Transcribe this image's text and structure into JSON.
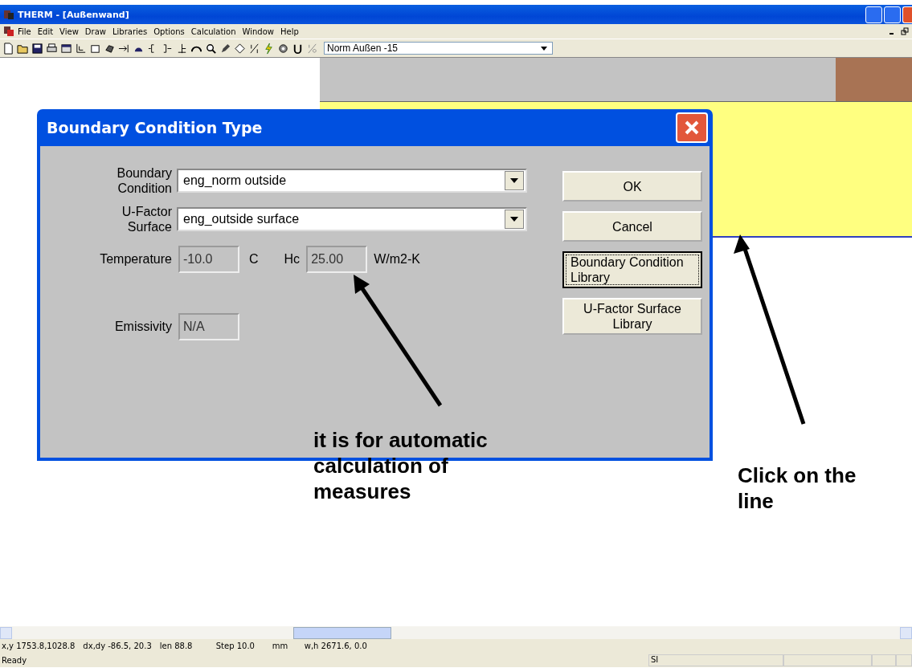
{
  "window": {
    "title": "THERM - [Außenwand]"
  },
  "menu": [
    "File",
    "Edit",
    "View",
    "Draw",
    "Libraries",
    "Options",
    "Calculation",
    "Window",
    "Help"
  ],
  "toolbar": {
    "condition_dropdown": "Norm Außen -15"
  },
  "dialog": {
    "title": "Boundary Condition Type",
    "selects": [
      {
        "label": "Boundary Condition",
        "value": "eng_norm outside"
      },
      {
        "label": "U-Factor Surface",
        "value": "eng_outside surface"
      }
    ],
    "temperature": {
      "label": "Temperature",
      "value": "-10.0",
      "unit": "C",
      "disabled": true
    },
    "hc": {
      "label": "Hc",
      "value": "25.00",
      "unit": "W/m2-K",
      "disabled": true
    },
    "emissivity": {
      "label": "Emissivity",
      "value": "N/A",
      "disabled": true
    },
    "buttons": [
      {
        "label": "OK",
        "focused": false
      },
      {
        "label": "Cancel",
        "focused": false
      },
      {
        "label": "Boundary Condition Library",
        "focused": true
      },
      {
        "label": "U-Factor Surface Library",
        "focused": false
      }
    ]
  },
  "annotations": [
    {
      "lines": [
        "it is for automatic",
        "calculation of",
        "measures"
      ]
    },
    {
      "lines": [
        "Click on the",
        "line"
      ]
    }
  ],
  "status_bar": {
    "fields": [
      "x,y 1753.8,1028.8",
      "dx,dy -86.5, 20.3",
      "len 88.8",
      "Step 10.0",
      "mm",
      "w,h 2671.6,  0.0"
    ],
    "message": "Ready",
    "units": "SI"
  }
}
